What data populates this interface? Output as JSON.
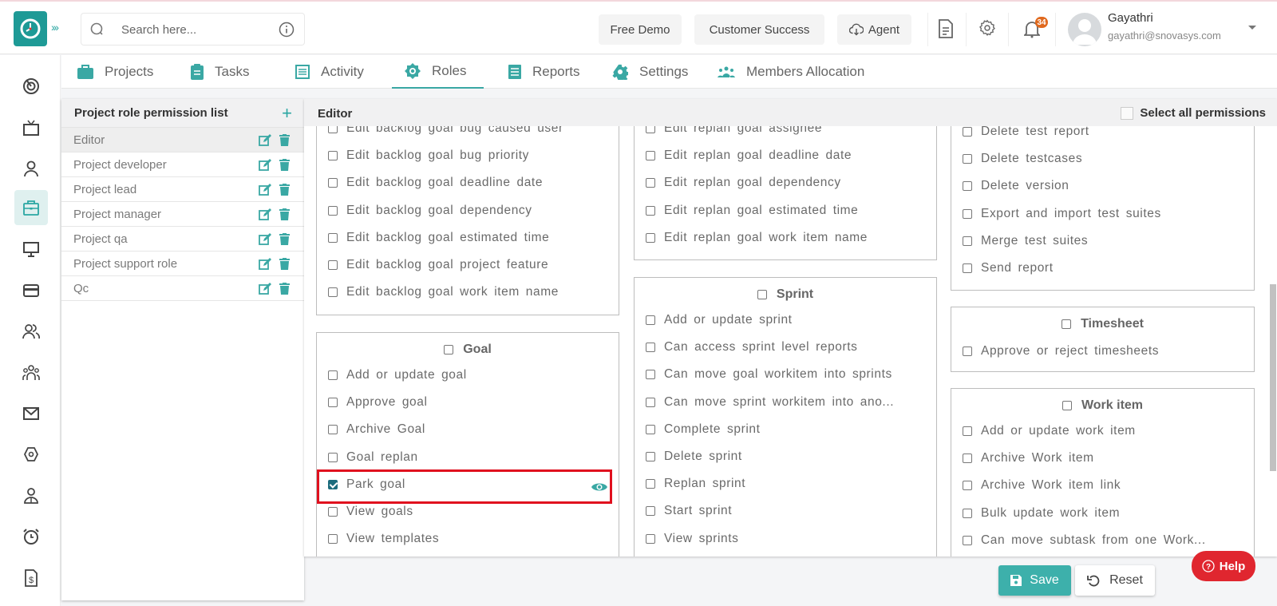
{
  "header": {
    "search_placeholder": "Search here...",
    "buttons": {
      "free_demo": "Free Demo",
      "customer_success": "Customer Success",
      "agent": "Agent"
    },
    "notification_count": "34",
    "user": {
      "name": "Gayathri",
      "email": "gayathri@snovasys.com"
    }
  },
  "sidebar": {
    "items": [
      {
        "icon": "dashboard-target-icon"
      },
      {
        "icon": "tv-icon"
      },
      {
        "icon": "user-icon"
      },
      {
        "icon": "briefcase-icon",
        "active": true
      },
      {
        "icon": "monitor-icon"
      },
      {
        "icon": "credit-card-icon"
      },
      {
        "icon": "users-icon"
      },
      {
        "icon": "team-icon"
      },
      {
        "icon": "mail-icon"
      },
      {
        "icon": "settings-icon"
      },
      {
        "icon": "user-badge-icon"
      },
      {
        "icon": "alarm-clock-icon"
      },
      {
        "icon": "invoice-icon"
      }
    ]
  },
  "tabs": [
    {
      "label": "Projects"
    },
    {
      "label": "Tasks"
    },
    {
      "label": "Activity"
    },
    {
      "label": "Roles",
      "active": true
    },
    {
      "label": "Reports"
    },
    {
      "label": "Settings"
    },
    {
      "label": "Members Allocation"
    }
  ],
  "role_list": {
    "title": "Project role permission list",
    "roles": [
      "Editor",
      "Project developer",
      "Project lead",
      "Project manager",
      "Project qa",
      "Project support role",
      "Qc"
    ],
    "selected": "Editor"
  },
  "editor": {
    "title": "Editor",
    "select_all_label": "Select all permissions",
    "col1_top": [
      "Edit backlog goal bug caused user",
      "Edit backlog goal bug priority",
      "Edit backlog goal deadline date",
      "Edit backlog goal dependency",
      "Edit backlog goal estimated time",
      "Edit backlog goal project feature",
      "Edit backlog goal work item name"
    ],
    "goal": {
      "title": "Goal",
      "items": [
        "Add or update goal",
        "Approve goal",
        "Archive Goal",
        "Goal replan",
        "Park goal",
        "View goals",
        "View templates"
      ],
      "checked": [
        "Park goal"
      ]
    },
    "col2_top": [
      "Edit replan goal assignee",
      "Edit replan goal deadline date",
      "Edit replan goal dependency",
      "Edit replan goal estimated time",
      "Edit replan goal work item name"
    ],
    "sprint": {
      "title": "Sprint",
      "items": [
        "Add or update sprint",
        "Can access sprint level reports",
        "Can move goal workitem into sprints",
        "Can move sprint workitem into ano...",
        "Complete sprint",
        "Delete sprint",
        "Replan sprint",
        "Start sprint",
        "View sprints"
      ]
    },
    "col3_top": [
      "Delete test report",
      "Delete testcases",
      "Delete version",
      "Export and import test suites",
      "Merge test suites",
      "Send report"
    ],
    "timesheet": {
      "title": "Timesheet",
      "items": [
        "Approve or reject timesheets"
      ]
    },
    "work_item": {
      "title": "Work item",
      "items": [
        "Add or update work item",
        "Archive Work item",
        "Archive Work item link",
        "Bulk update work item",
        "Can move subtask from one Work..."
      ]
    }
  },
  "actions": {
    "save": "Save",
    "reset": "Reset",
    "help": "Help"
  },
  "colors": {
    "accent": "#3db0ab",
    "brand": "#1e9a96",
    "highlight": "#e0101e",
    "help": "#e0262f",
    "badge": "#e0691e"
  }
}
